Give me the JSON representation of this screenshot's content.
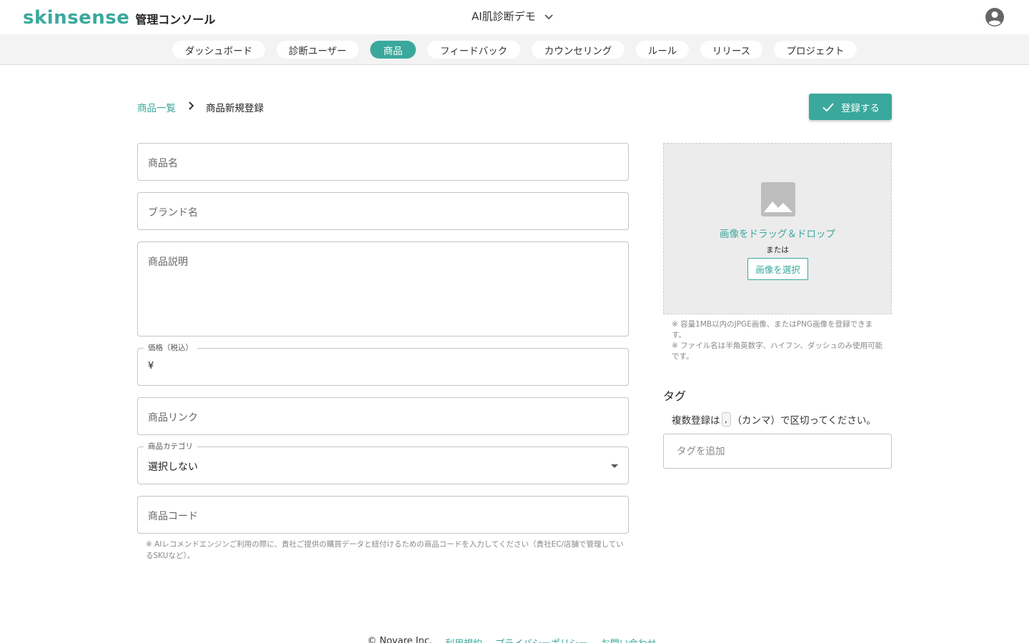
{
  "header": {
    "logo_text": "skinsense",
    "logo_subtitle": "管理コンソール",
    "project_name": "AI肌診断デモ"
  },
  "nav": {
    "items": [
      {
        "label": "ダッシュボード"
      },
      {
        "label": "診断ユーザー"
      },
      {
        "label": "商品"
      },
      {
        "label": "フィードバック"
      },
      {
        "label": "カウンセリング"
      },
      {
        "label": "ルール"
      },
      {
        "label": "リリース"
      },
      {
        "label": "プロジェクト"
      }
    ],
    "active_index": 2
  },
  "breadcrumb": {
    "parent": "商品一覧",
    "current": "商品新規登録"
  },
  "actions": {
    "register_label": "登録する"
  },
  "form": {
    "product_name_placeholder": "商品名",
    "brand_name_placeholder": "ブランド名",
    "description_placeholder": "商品説明",
    "price_label": "価格（税込）",
    "price_prefix": "¥",
    "link_placeholder": "商品リンク",
    "category_label": "商品カテゴリ",
    "category_value": "選択しない",
    "code_placeholder": "商品コード",
    "code_note": "※ AIレコメンドエンジンご利用の際に、貴社ご提供の購買データと紐付けるための商品コードを入力してください（貴社EC/店舗で管理しているSKUなど）。"
  },
  "image": {
    "drop_text": "画像をドラッグ＆ドロップ",
    "or_text": "または",
    "choose_label": "画像を選択",
    "note1": "※ 容量1MB以内のJPGE画像、またはPNG画像を登録できます。",
    "note2": "※ ファイル名は半角英数字、ハイフン、ダッシュのみ使用可能です。"
  },
  "tags": {
    "title": "タグ",
    "help_before": "複数登録は",
    "help_chip": ",",
    "help_after": "（カンマ）で区切ってください。",
    "input_placeholder": "タグを追加"
  },
  "footer": {
    "copyright": "© Novare Inc.",
    "terms": "利用規約",
    "privacy": "プライバシーポリシー",
    "contact": "お問い合わせ"
  },
  "colors": {
    "accent": "#3aa89c"
  }
}
